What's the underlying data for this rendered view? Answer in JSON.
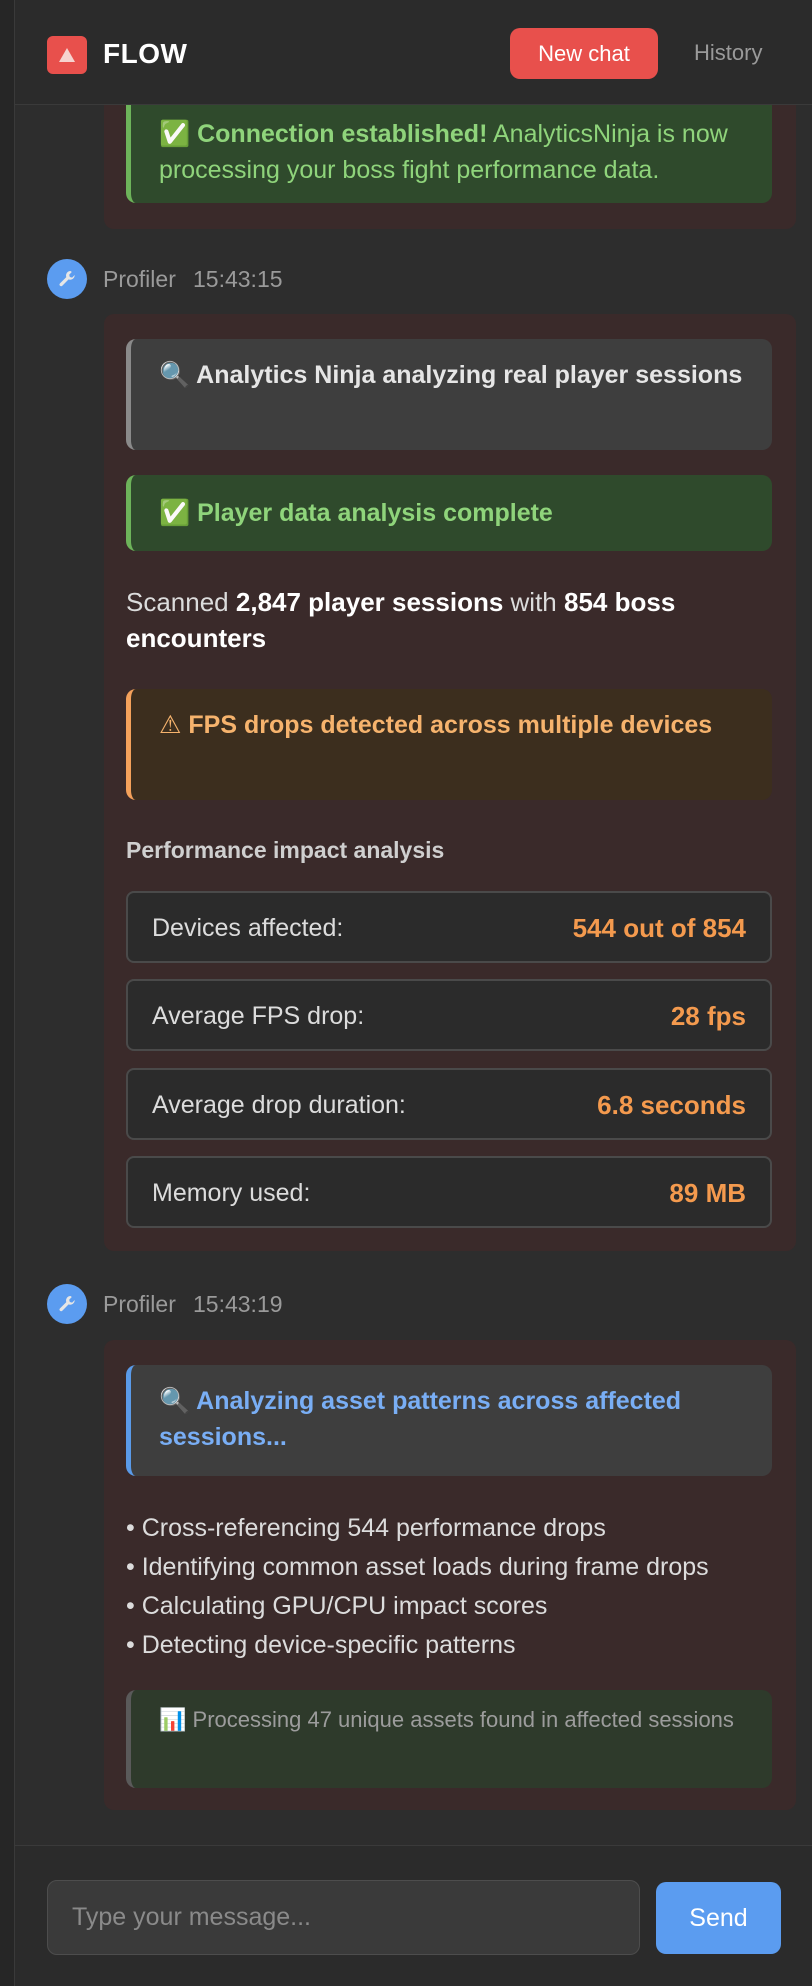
{
  "header": {
    "app_title": "FLOW",
    "logo_icon": "warning-triangle-icon",
    "new_chat_label": "New chat",
    "history_label": "History"
  },
  "messages": [
    {
      "banner_connection": {
        "icon": "✅",
        "title": "Connection established!",
        "text": "AnalyticsNinja is now processing your boss fight performance data."
      }
    },
    {
      "author": "Profiler",
      "time": "15:43:15",
      "avatar_icon": "wrench-icon",
      "banner_analyzing": {
        "icon": "🔍",
        "text": "Analytics Ninja analyzing real player sessions"
      },
      "banner_complete": {
        "icon": "✅",
        "text": "Player data analysis complete"
      },
      "scanned": {
        "prefix": "Scanned",
        "sessions": "2,847 player sessions",
        "middle": "with",
        "encounters": "854 boss encounters"
      },
      "banner_warning": {
        "icon": "⚠",
        "text": "FPS drops detected across multiple devices"
      },
      "section_title": "Performance impact analysis",
      "metrics": [
        {
          "label": "Devices affected:",
          "value": "544 out of 854"
        },
        {
          "label": "Average FPS drop:",
          "value": "28 fps"
        },
        {
          "label": "Average drop duration:",
          "value": "6.8 seconds"
        },
        {
          "label": "Memory used:",
          "value": "89 MB"
        }
      ]
    },
    {
      "author": "Profiler",
      "time": "15:43:19",
      "avatar_icon": "wrench-icon",
      "banner_assets": {
        "icon": "🔍",
        "text": "Analyzing asset patterns across affected sessions..."
      },
      "bullets": [
        "Cross-referencing 544 performance drops",
        "Identifying common asset loads during frame drops",
        "Calculating GPU/CPU impact scores",
        "Detecting device-specific patterns"
      ],
      "banner_processing": {
        "icon": "📊",
        "text": "Processing 47 unique assets found in affected sessions"
      }
    }
  ],
  "composer": {
    "placeholder": "Type your message...",
    "send_label": "Send"
  },
  "colors": {
    "brand_red": "#e8504c",
    "accent_blue": "#5b9cf0",
    "metric_orange": "#f49a4e",
    "success_green": "#8fd47b"
  }
}
